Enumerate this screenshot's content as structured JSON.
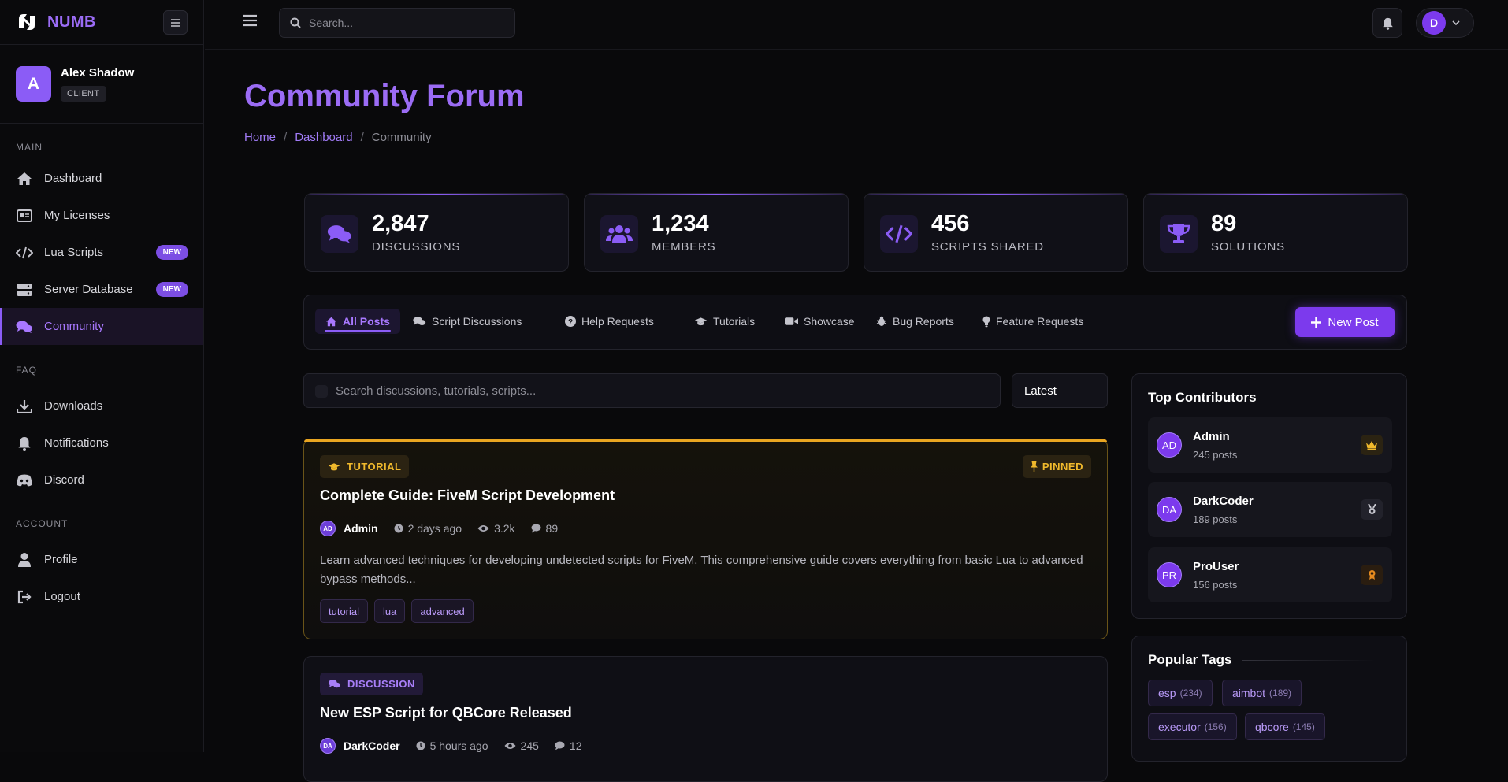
{
  "brand": {
    "name": "NUMB"
  },
  "user": {
    "initial": "A",
    "name": "Alex Shadow",
    "role": "CLIENT"
  },
  "sidebar": {
    "sections": [
      {
        "title": "MAIN"
      },
      {
        "title": "FAQ"
      },
      {
        "title": "ACCOUNT"
      }
    ],
    "items": [
      {
        "label": "Dashboard",
        "icon": "home-icon"
      },
      {
        "label": "My Licenses",
        "icon": "id-card-icon"
      },
      {
        "label": "Lua Scripts",
        "icon": "code-icon",
        "badge": "NEW"
      },
      {
        "label": "Server Database",
        "icon": "server-icon",
        "badge": "NEW"
      },
      {
        "label": "Community",
        "icon": "comments-icon",
        "active": true
      },
      {
        "label": "Downloads",
        "icon": "download-icon"
      },
      {
        "label": "Notifications",
        "icon": "bell-icon"
      },
      {
        "label": "Discord",
        "icon": "discord-icon"
      },
      {
        "label": "Profile",
        "icon": "user-icon"
      },
      {
        "label": "Logout",
        "icon": "logout-icon"
      }
    ]
  },
  "topbar": {
    "search_placeholder": "Search...",
    "profile_initial": "D"
  },
  "page": {
    "title": "Community Forum",
    "breadcrumb": [
      "Home",
      "Dashboard",
      "Community"
    ]
  },
  "stats": [
    {
      "value": "2,847",
      "label": "DISCUSSIONS",
      "icon": "comments-icon"
    },
    {
      "value": "1,234",
      "label": "MEMBERS",
      "icon": "users-icon"
    },
    {
      "value": "456",
      "label": "SCRIPTS SHARED",
      "icon": "code-icon"
    },
    {
      "value": "89",
      "label": "SOLUTIONS",
      "icon": "trophy-icon"
    }
  ],
  "tabs": [
    {
      "label": "All Posts",
      "icon": "home-icon",
      "active": true
    },
    {
      "label": "Script Discussions",
      "icon": "comments-icon"
    },
    {
      "label": "Help Requests",
      "icon": "question-icon"
    },
    {
      "label": "Tutorials",
      "icon": "graduation-cap-icon"
    },
    {
      "label": "Showcase",
      "icon": "video-icon"
    },
    {
      "label": "Bug Reports",
      "icon": "bug-icon"
    },
    {
      "label": "Feature Requests",
      "icon": "lightbulb-icon"
    }
  ],
  "new_post_label": "New Post",
  "forum_search": {
    "placeholder": "Search discussions, tutorials, scripts..."
  },
  "sort": {
    "selected": "Latest"
  },
  "posts": [
    {
      "category": "TUTORIAL",
      "pinned_label": "PINNED",
      "title": "Complete Guide: FiveM Script Development",
      "author_initials": "AD",
      "author": "Admin",
      "time": "2 days ago",
      "views": "3.2k",
      "replies": "89",
      "excerpt": "Learn advanced techniques for developing undetected scripts for FiveM. This comprehensive guide covers everything from basic Lua to advanced bypass methods...",
      "tags": [
        "tutorial",
        "lua",
        "advanced"
      ]
    },
    {
      "category": "DISCUSSION",
      "title": "New ESP Script for QBCore Released",
      "author_initials": "DA",
      "author": "DarkCoder",
      "time": "5 hours ago",
      "views": "245",
      "replies": "12"
    }
  ],
  "top_contributors": {
    "title": "Top Contributors",
    "items": [
      {
        "initials": "AD",
        "name": "Admin",
        "posts": "245 posts",
        "medal": "crown-icon",
        "medal_color": "#f0b92c"
      },
      {
        "initials": "DA",
        "name": "DarkCoder",
        "posts": "189 posts",
        "medal": "silver-medal-icon",
        "medal_color": "#c4c4cc"
      },
      {
        "initials": "PR",
        "name": "ProUser",
        "posts": "156 posts",
        "medal": "bronze-medal-icon",
        "medal_color": "#e58a1f"
      }
    ]
  },
  "popular_tags": {
    "title": "Popular Tags",
    "items": [
      {
        "name": "esp",
        "count": "(234)"
      },
      {
        "name": "aimbot",
        "count": "(189)"
      },
      {
        "name": "executor",
        "count": "(156)"
      },
      {
        "name": "qbcore",
        "count": "(145)"
      }
    ]
  },
  "colors": {
    "accent": "#8b5cf6",
    "pinned": "#e9a521",
    "background": "#09090b"
  }
}
